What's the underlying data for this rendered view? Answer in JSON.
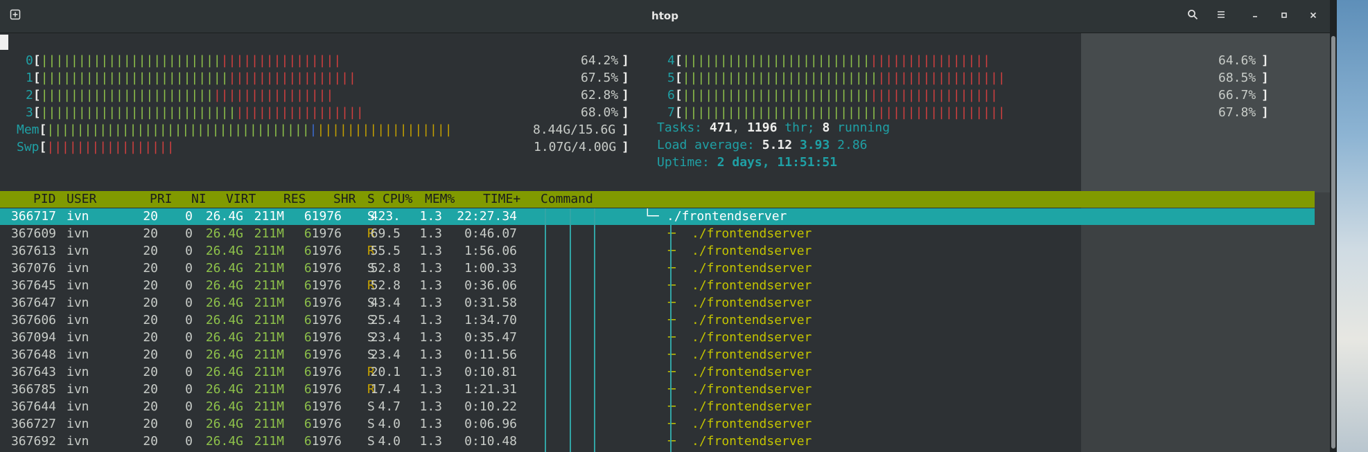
{
  "window": {
    "title": "htop"
  },
  "cpu_meters": [
    {
      "index": "0",
      "value": "64.2%",
      "fill": 0.642
    },
    {
      "index": "1",
      "value": "67.5%",
      "fill": 0.675
    },
    {
      "index": "2",
      "value": "62.8%",
      "fill": 0.628
    },
    {
      "index": "3",
      "value": "68.0%",
      "fill": 0.68
    },
    {
      "index": "4",
      "value": "64.6%",
      "fill": 0.646
    },
    {
      "index": "5",
      "value": "68.5%",
      "fill": 0.685
    },
    {
      "index": "6",
      "value": "66.7%",
      "fill": 0.667
    },
    {
      "index": "7",
      "value": "67.8%",
      "fill": 0.678
    }
  ],
  "mem": {
    "label": "Mem",
    "value": "8.44G/15.6G"
  },
  "swp": {
    "label": "Swp",
    "value": "1.07G/4.00G"
  },
  "tasks": {
    "label": "Tasks:",
    "count": "471",
    "threads": "1196",
    "thr_label": "thr;",
    "running": "8",
    "running_label": "running"
  },
  "load": {
    "label": "Load average:",
    "one": "5.12",
    "five": "3.93",
    "fifteen": "2.86"
  },
  "uptime": {
    "label": "Uptime:",
    "value": "2 days, 11:51:51"
  },
  "columns": [
    "PID",
    "USER",
    "PRI",
    "NI",
    "VIRT",
    "RES",
    "SHR",
    "S",
    "CPU%",
    "MEM%",
    "TIME+",
    "Command"
  ],
  "processes": [
    {
      "pid": "366717",
      "user": "ivn",
      "pri": "20",
      "ni": "0",
      "virt": "26.4G",
      "res": "211M",
      "shr": "61976",
      "s": "S",
      "cpu": "423.",
      "mem": "1.3",
      "time": "22:27.34",
      "tree": "└─",
      "cmd": "./frontendserver",
      "selected": true
    },
    {
      "pid": "367609",
      "user": "ivn",
      "pri": "20",
      "ni": "0",
      "virt": "26.4G",
      "res": "211M",
      "shr": "61976",
      "s": "R",
      "cpu": "69.5",
      "mem": "1.3",
      "time": "0:46.07",
      "tree": "─",
      "cmd": "./frontendserver"
    },
    {
      "pid": "367613",
      "user": "ivn",
      "pri": "20",
      "ni": "0",
      "virt": "26.4G",
      "res": "211M",
      "shr": "61976",
      "s": "R",
      "cpu": "55.5",
      "mem": "1.3",
      "time": "1:56.06",
      "tree": "─",
      "cmd": "./frontendserver"
    },
    {
      "pid": "367076",
      "user": "ivn",
      "pri": "20",
      "ni": "0",
      "virt": "26.4G",
      "res": "211M",
      "shr": "61976",
      "s": "S",
      "cpu": "52.8",
      "mem": "1.3",
      "time": "1:00.33",
      "tree": "─",
      "cmd": "./frontendserver"
    },
    {
      "pid": "367645",
      "user": "ivn",
      "pri": "20",
      "ni": "0",
      "virt": "26.4G",
      "res": "211M",
      "shr": "61976",
      "s": "R",
      "cpu": "52.8",
      "mem": "1.3",
      "time": "0:36.06",
      "tree": "─",
      "cmd": "./frontendserver"
    },
    {
      "pid": "367647",
      "user": "ivn",
      "pri": "20",
      "ni": "0",
      "virt": "26.4G",
      "res": "211M",
      "shr": "61976",
      "s": "S",
      "cpu": "43.4",
      "mem": "1.3",
      "time": "0:31.58",
      "tree": "─",
      "cmd": "./frontendserver"
    },
    {
      "pid": "367606",
      "user": "ivn",
      "pri": "20",
      "ni": "0",
      "virt": "26.4G",
      "res": "211M",
      "shr": "61976",
      "s": "S",
      "cpu": "25.4",
      "mem": "1.3",
      "time": "1:34.70",
      "tree": "─",
      "cmd": "./frontendserver"
    },
    {
      "pid": "367094",
      "user": "ivn",
      "pri": "20",
      "ni": "0",
      "virt": "26.4G",
      "res": "211M",
      "shr": "61976",
      "s": "S",
      "cpu": "23.4",
      "mem": "1.3",
      "time": "0:35.47",
      "tree": "─",
      "cmd": "./frontendserver"
    },
    {
      "pid": "367648",
      "user": "ivn",
      "pri": "20",
      "ni": "0",
      "virt": "26.4G",
      "res": "211M",
      "shr": "61976",
      "s": "S",
      "cpu": "23.4",
      "mem": "1.3",
      "time": "0:11.56",
      "tree": "─",
      "cmd": "./frontendserver"
    },
    {
      "pid": "367643",
      "user": "ivn",
      "pri": "20",
      "ni": "0",
      "virt": "26.4G",
      "res": "211M",
      "shr": "61976",
      "s": "R",
      "cpu": "20.1",
      "mem": "1.3",
      "time": "0:10.81",
      "tree": "─",
      "cmd": "./frontendserver"
    },
    {
      "pid": "366785",
      "user": "ivn",
      "pri": "20",
      "ni": "0",
      "virt": "26.4G",
      "res": "211M",
      "shr": "61976",
      "s": "R",
      "cpu": "17.4",
      "mem": "1.3",
      "time": "1:21.31",
      "tree": "─",
      "cmd": "./frontendserver"
    },
    {
      "pid": "367644",
      "user": "ivn",
      "pri": "20",
      "ni": "0",
      "virt": "26.4G",
      "res": "211M",
      "shr": "61976",
      "s": "S",
      "cpu": "4.7",
      "mem": "1.3",
      "time": "0:10.22",
      "tree": "─",
      "cmd": "./frontendserver"
    },
    {
      "pid": "366727",
      "user": "ivn",
      "pri": "20",
      "ni": "0",
      "virt": "26.4G",
      "res": "211M",
      "shr": "61976",
      "s": "S",
      "cpu": "4.0",
      "mem": "1.3",
      "time": "0:06.96",
      "tree": "─",
      "cmd": "./frontendserver"
    },
    {
      "pid": "367692",
      "user": "ivn",
      "pri": "20",
      "ni": "0",
      "virt": "26.4G",
      "res": "211M",
      "shr": "61976",
      "s": "S",
      "cpu": "4.0",
      "mem": "1.3",
      "time": "0:10.48",
      "tree": "─",
      "cmd": "./frontendserver"
    }
  ],
  "colors": {
    "accent_green": "#819a00",
    "selection": "#1ea5a5",
    "title_bg": "#2e3436"
  }
}
